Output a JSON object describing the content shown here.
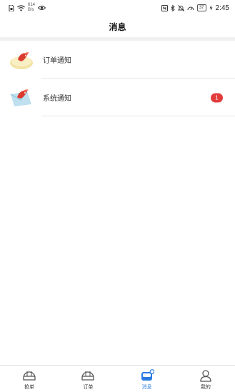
{
  "status_bar": {
    "network_speed_value": "614",
    "network_speed_unit": "B/s",
    "battery": "37",
    "time": "2:45"
  },
  "header": {
    "title": "消息"
  },
  "messages": [
    {
      "label": "订单通知",
      "badge": ""
    },
    {
      "label": "系统通知",
      "badge": "1"
    }
  ],
  "tabs": [
    {
      "label": "抢单",
      "icon": "helmet-icon",
      "active": false
    },
    {
      "label": "订单",
      "icon": "helmet-icon",
      "active": false
    },
    {
      "label": "消息",
      "icon": "message-box-icon",
      "active": true
    },
    {
      "label": "我的",
      "icon": "person-icon",
      "active": false
    }
  ],
  "colors": {
    "accent": "#2a7be0",
    "badge": "#e23b3b"
  }
}
